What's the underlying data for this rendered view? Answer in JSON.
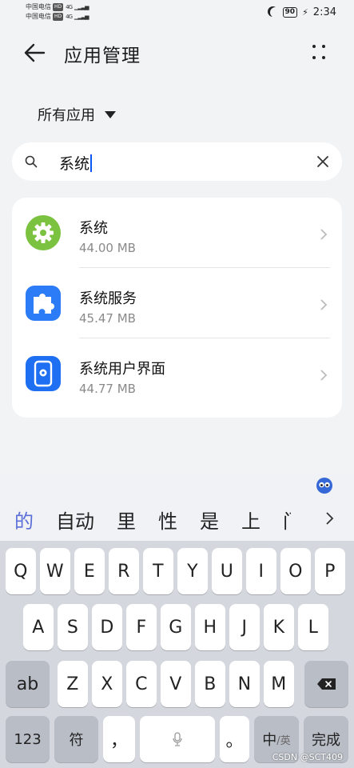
{
  "status": {
    "carrier1": "中国电信",
    "hd1": "HD",
    "net1": "4G",
    "carrier2": "中国电信",
    "hd2": "HD",
    "net2": "4G",
    "battery": "90",
    "time": "2:34"
  },
  "header": {
    "title": "应用管理"
  },
  "filter": {
    "label": "所有应用"
  },
  "search": {
    "value": "系统"
  },
  "apps": [
    {
      "name": "系统",
      "size": "44.00 MB",
      "icon": "gear-icon",
      "color": "#7cc241"
    },
    {
      "name": "系统服务",
      "size": "45.47 MB",
      "icon": "puzzle-icon",
      "color": "#2b7cf6"
    },
    {
      "name": "系统用户界面",
      "size": "44.77 MB",
      "icon": "phone-gear-icon",
      "color": "#1e6ff2"
    }
  ],
  "candidates": [
    "的",
    "自动",
    "里",
    "性",
    "是",
    "上",
    "门"
  ],
  "keyboard": {
    "row1": [
      "Q",
      "W",
      "E",
      "R",
      "T",
      "Y",
      "U",
      "I",
      "O",
      "P"
    ],
    "row2": [
      "A",
      "S",
      "D",
      "F",
      "G",
      "H",
      "J",
      "K",
      "L"
    ],
    "shift": "ab",
    "row3": [
      "Z",
      "X",
      "C",
      "V",
      "B",
      "N",
      "M"
    ],
    "num": "123",
    "sym": "符",
    "comma": "，",
    "period": "。",
    "lang_main": "中",
    "lang_alt": "/英",
    "done": "完成"
  },
  "watermark": "CSDN @SCT409"
}
